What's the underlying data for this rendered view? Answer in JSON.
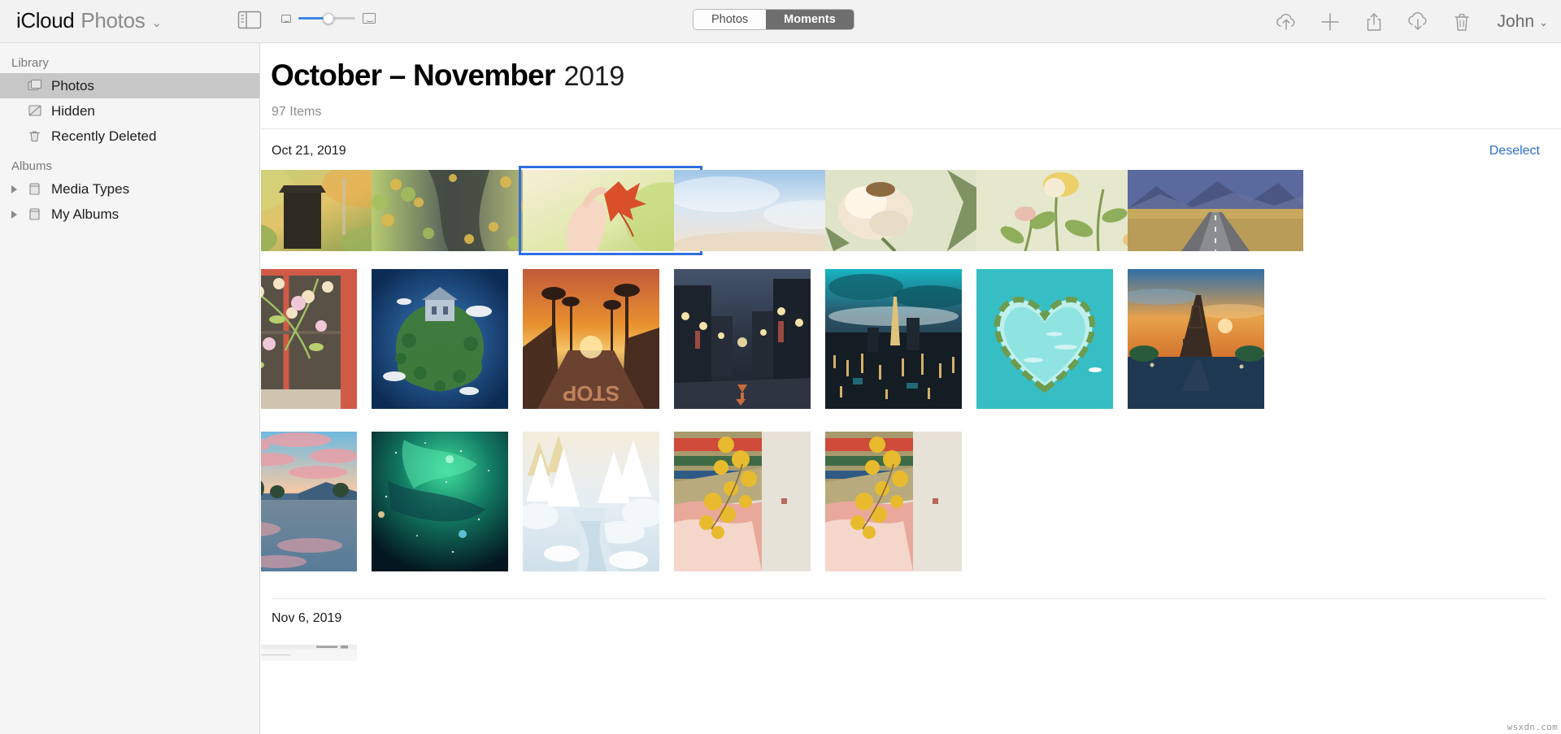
{
  "toolbar": {
    "brand_primary": "iCloud",
    "brand_secondary": "Photos",
    "brand_chevron": "⌄",
    "sidebar_toggle_icon": "sidebar-toggle-icon",
    "zoom_small_icon": "small-thumbnail-icon",
    "zoom_large_icon": "large-thumbnail-icon",
    "segmented": [
      {
        "label": "Photos",
        "selected": false
      },
      {
        "label": "Moments",
        "selected": true
      }
    ],
    "actions": [
      {
        "name": "upload-icon",
        "title": "Upload"
      },
      {
        "name": "add-icon",
        "title": "Add"
      },
      {
        "name": "share-icon",
        "title": "Share"
      },
      {
        "name": "download-icon",
        "title": "Download"
      },
      {
        "name": "trash-icon",
        "title": "Delete"
      }
    ],
    "user_name": "John",
    "user_chevron": "⌄"
  },
  "sidebar": {
    "sections": [
      {
        "header": "Library",
        "items": [
          {
            "label": "Photos",
            "icon": "photos-stack-icon",
            "selected": true,
            "expandable": false
          },
          {
            "label": "Hidden",
            "icon": "hidden-icon",
            "selected": false,
            "expandable": false
          },
          {
            "label": "Recently Deleted",
            "icon": "trash-icon",
            "selected": false,
            "expandable": false
          }
        ]
      },
      {
        "header": "Albums",
        "items": [
          {
            "label": "Media Types",
            "icon": "album-icon",
            "selected": false,
            "expandable": true
          },
          {
            "label": "My Albums",
            "icon": "album-icon",
            "selected": false,
            "expandable": true
          }
        ]
      }
    ]
  },
  "main": {
    "title_bold": "October – November",
    "title_light": "2019",
    "item_count": "97 Items",
    "sections": [
      {
        "date": "Oct 21, 2019",
        "action_label": "Deselect",
        "rows": [
          {
            "photos": [
              {
                "alt": "wooden-birdhouse-autumn",
                "selected": false
              },
              {
                "alt": "ivy-stone-wall-autumn",
                "selected": false
              },
              {
                "alt": "red-maple-leaf-in-hand",
                "selected": true
              },
              {
                "alt": "pastel-sky-clouds",
                "selected": false
              },
              {
                "alt": "wilted-cream-rose",
                "selected": false
              },
              {
                "alt": "yellow-rose-stems",
                "selected": false
              },
              {
                "alt": "desert-highway-mountains",
                "selected": false
              }
            ]
          },
          {
            "photos": [
              {
                "alt": "pink-blossoms-red-wall",
                "selected": false
              },
              {
                "alt": "tiny-planet-house",
                "selected": false
              },
              {
                "alt": "palm-street-sunset-stop",
                "selected": false
              },
              {
                "alt": "night-city-street-lanterns",
                "selected": false
              },
              {
                "alt": "city-skyline-dusk-tower",
                "selected": false
              },
              {
                "alt": "heart-shaped-island-lagoon",
                "selected": false
              },
              {
                "alt": "eiffel-tower-sunset",
                "selected": false
              }
            ]
          },
          {
            "photos": [
              {
                "alt": "lake-reflection-pink-clouds",
                "selected": false
              },
              {
                "alt": "green-aurora-night-sky",
                "selected": false
              },
              {
                "alt": "snowy-forest-winter-path",
                "selected": false
              },
              {
                "alt": "ginkgo-tree-temple-wall",
                "selected": false
              },
              {
                "alt": "ginkgo-tree-temple-wall-2",
                "selected": false
              }
            ]
          }
        ]
      },
      {
        "date": "Nov 6, 2019",
        "action_label": "",
        "rows": [
          {
            "photos": [
              {
                "alt": "screenshot-document-thumb",
                "selected": false
              }
            ]
          }
        ]
      }
    ]
  },
  "watermark": "wsxdn.com",
  "colors": {
    "accent_blue": "#2a6fd6",
    "selection_blue": "#2f6ee0",
    "toolbar_bg": "#f2f2f2",
    "sidebar_bg": "#f5f5f5",
    "sidebar_selected": "#c7c7c7",
    "segment_active_bg": "#6e6e6e"
  }
}
